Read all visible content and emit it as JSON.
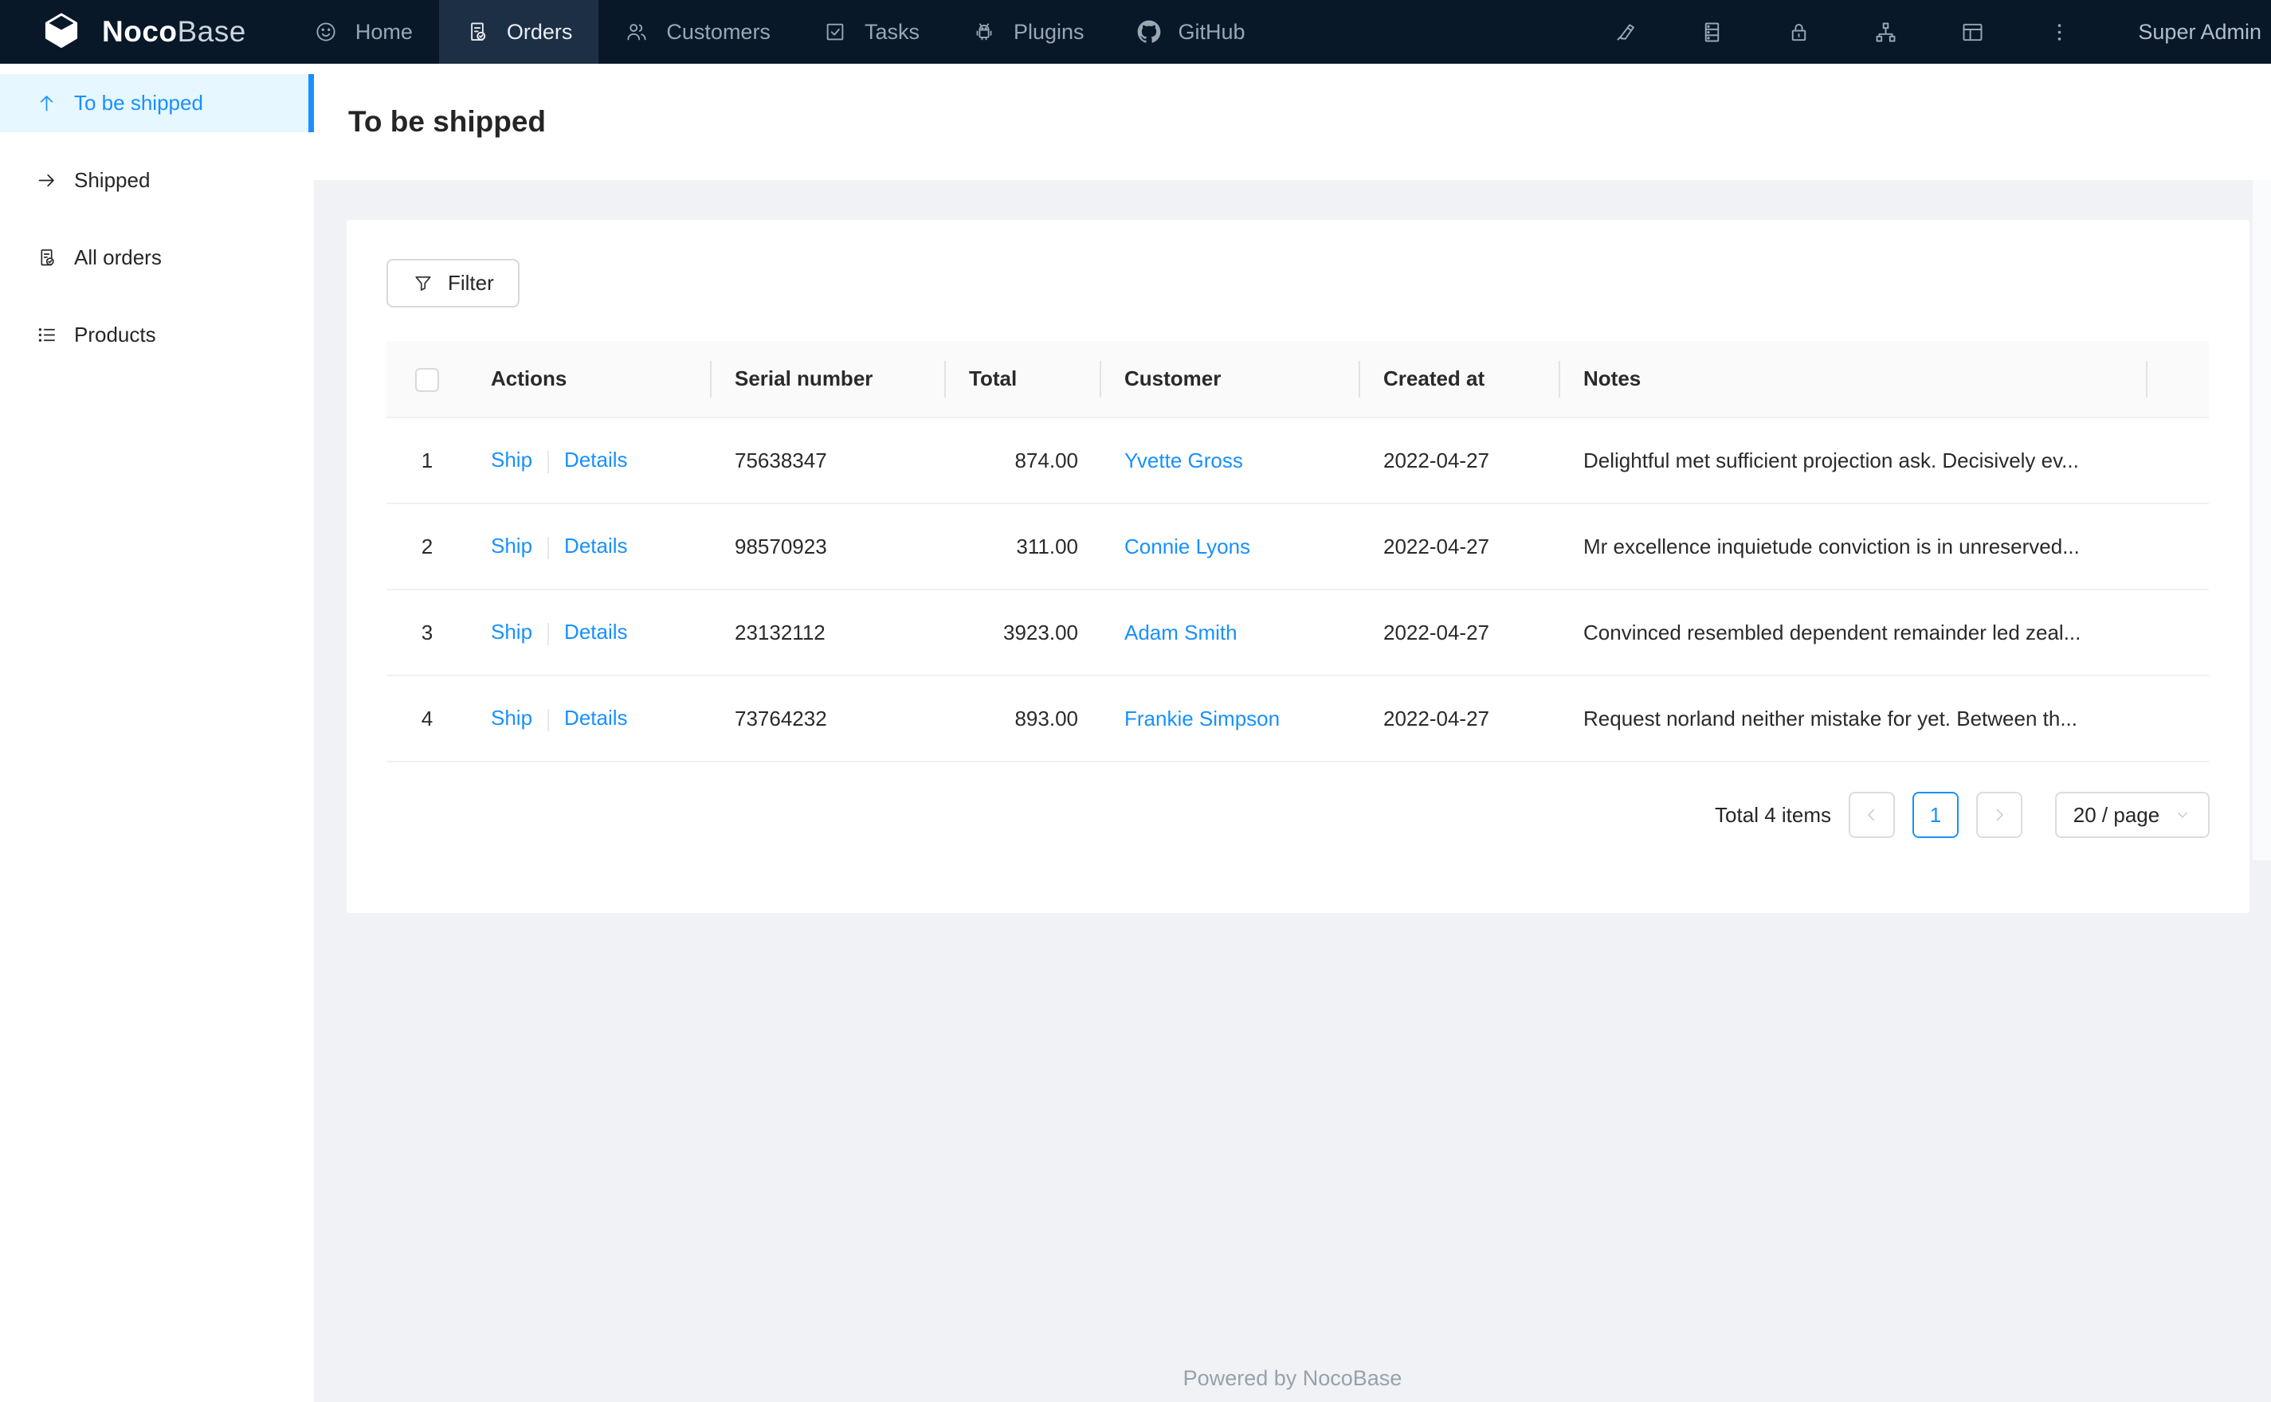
{
  "nav": {
    "logo": {
      "bold": "Noco",
      "light": "Base"
    },
    "items": [
      {
        "icon": "smile-icon",
        "label": "Home",
        "active": false
      },
      {
        "icon": "orders-file-icon",
        "label": "Orders",
        "active": true
      },
      {
        "icon": "team-icon",
        "label": "Customers",
        "active": false
      },
      {
        "icon": "check-square-icon",
        "label": "Tasks",
        "active": false
      },
      {
        "icon": "robot-icon",
        "label": "Plugins",
        "active": false
      },
      {
        "icon": "github-icon",
        "label": "GitHub",
        "active": false
      }
    ],
    "right_icons": [
      "highlighter-icon",
      "database-icon",
      "lock-icon",
      "apartment-icon",
      "layout-icon",
      "more-vertical-icon"
    ],
    "user": "Super Admin"
  },
  "sidebar": {
    "items": [
      {
        "icon": "arrow-up-icon",
        "label": "To be shipped",
        "active": true
      },
      {
        "icon": "arrow-right-icon",
        "label": "Shipped",
        "active": false
      },
      {
        "icon": "file-done-icon",
        "label": "All orders",
        "active": false
      },
      {
        "icon": "list-icon",
        "label": "Products",
        "active": false
      }
    ]
  },
  "page": {
    "title": "To be shipped"
  },
  "toolbar": {
    "filter_label": "Filter"
  },
  "table": {
    "columns": [
      "Actions",
      "Serial number",
      "Total",
      "Customer",
      "Created at",
      "Notes"
    ],
    "rows": [
      {
        "index": "1",
        "actions": [
          "Ship",
          "Details"
        ],
        "serial": "75638347",
        "total": "874.00",
        "customer": "Yvette Gross",
        "created": "2022-04-27",
        "notes": "Delightful met sufficient projection ask. Decisively ev..."
      },
      {
        "index": "2",
        "actions": [
          "Ship",
          "Details"
        ],
        "serial": "98570923",
        "total": "311.00",
        "customer": "Connie Lyons",
        "created": "2022-04-27",
        "notes": "Mr excellence inquietude conviction is in unreserved..."
      },
      {
        "index": "3",
        "actions": [
          "Ship",
          "Details"
        ],
        "serial": "23132112",
        "total": "3923.00",
        "customer": "Adam Smith",
        "created": "2022-04-27",
        "notes": "Convinced resembled dependent remainder led zeal..."
      },
      {
        "index": "4",
        "actions": [
          "Ship",
          "Details"
        ],
        "serial": "73764232",
        "total": "893.00",
        "customer": "Frankie Simpson",
        "created": "2022-04-27",
        "notes": "Request norland neither mistake for yet. Between th..."
      }
    ]
  },
  "pagination": {
    "total_text": "Total 4 items",
    "current": "1",
    "page_size": "20 / page"
  },
  "footer": {
    "text": "Powered by NocoBase"
  },
  "colors": {
    "nav_bg": "#081829",
    "nav_active_bg": "#1d2f44",
    "accent": "#1890ff",
    "sidebar_active_bg": "#e6f7ff",
    "content_bg": "#f0f2f5",
    "table_header_bg": "#fafafa"
  }
}
